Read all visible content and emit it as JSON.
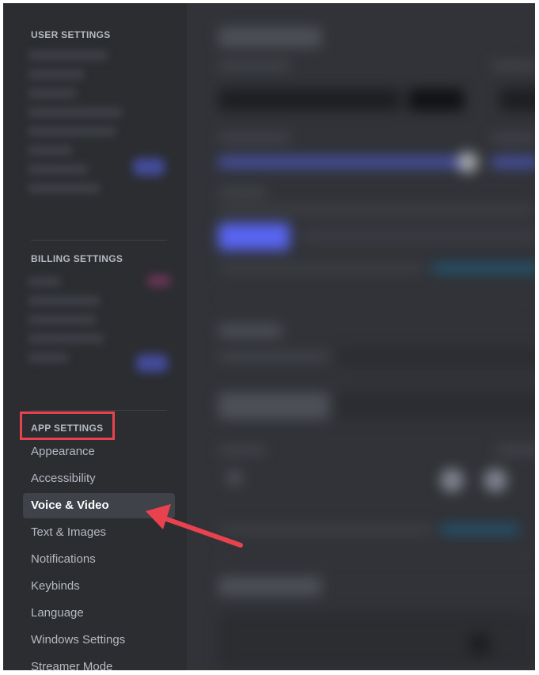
{
  "sidebar": {
    "user_settings_header": "USER SETTINGS",
    "billing_settings_header": "BILLING SETTINGS",
    "app_settings_header": "APP SETTINGS",
    "app_items": [
      {
        "label": "Appearance",
        "selected": false
      },
      {
        "label": "Accessibility",
        "selected": false
      },
      {
        "label": "Voice & Video",
        "selected": true
      },
      {
        "label": "Text & Images",
        "selected": false
      },
      {
        "label": "Notifications",
        "selected": false
      },
      {
        "label": "Keybinds",
        "selected": false
      },
      {
        "label": "Language",
        "selected": false
      },
      {
        "label": "Windows Settings",
        "selected": false
      },
      {
        "label": "Streamer Mode",
        "selected": false
      }
    ]
  },
  "colors": {
    "sidebar_bg": "#2b2d31",
    "content_bg": "#313338",
    "selected_item_bg": "#404249",
    "blurple": "#5865f2",
    "annotation_red": "#e8424f"
  },
  "annotations": {
    "highlight": "box-around-app-settings-header",
    "arrow": "arrow-pointing-to-voice-and-video"
  }
}
